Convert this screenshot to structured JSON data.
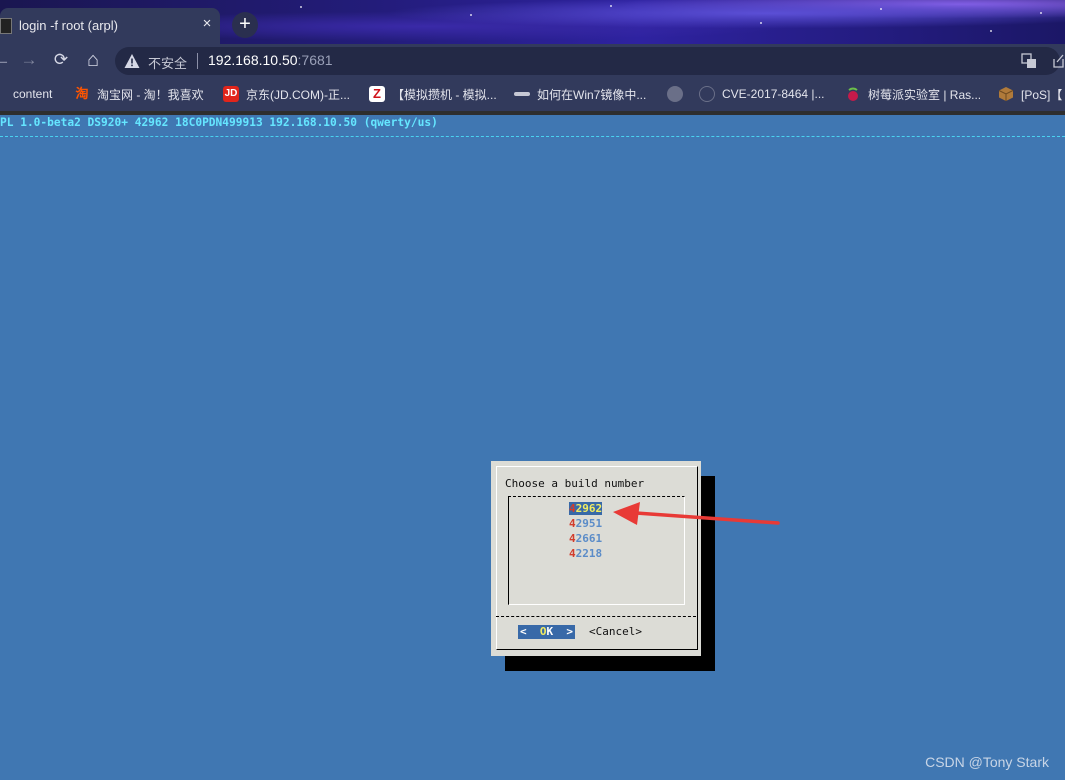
{
  "browser": {
    "tab_title": "login -f root (arpl)",
    "tab_close": "×",
    "new_tab": "+",
    "nav": {
      "back": "←",
      "forward": "→",
      "reload": "⟳",
      "home": "⌂"
    },
    "insecure_label": "不安全",
    "url_host": "192.168.10.50",
    "url_port": ":7681"
  },
  "bookmarks": [
    {
      "label": "content",
      "icon": "globe-icon",
      "glyph": ""
    },
    {
      "label": "淘宝网 - 淘！我喜欢",
      "icon": "taobao-icon",
      "glyph": "淘"
    },
    {
      "label": "京东(JD.COM)-正...",
      "icon": "jd-icon",
      "glyph": "JD"
    },
    {
      "label": "【模拟攒机 - 模拟...",
      "icon": "zol-icon",
      "glyph": "Z"
    },
    {
      "label": "如何在Win7镜像中...",
      "icon": "site-icon",
      "glyph": ""
    },
    {
      "label": "",
      "icon": "globe-icon",
      "glyph": ""
    },
    {
      "label": "CVE-2017-8464 |...",
      "icon": "shield-icon",
      "glyph": ""
    },
    {
      "label": "树莓派实验室 | Ras...",
      "icon": "raspberry-icon",
      "glyph": ""
    },
    {
      "label": "[PoS]【",
      "icon": "box-icon",
      "glyph": ""
    }
  ],
  "terminal": {
    "header": "PL 1.0-beta2 DS920+ 42962 18C0PDN499913 192.168.10.50 (qwerty/us)",
    "dialog": {
      "prompt": "Choose a build number",
      "items": [
        {
          "hotkey": "4",
          "rest": "2962",
          "selected": true
        },
        {
          "hotkey": "4",
          "rest": "2951",
          "selected": false
        },
        {
          "hotkey": "4",
          "rest": "2661",
          "selected": false
        },
        {
          "hotkey": "4",
          "rest": "2218",
          "selected": false
        }
      ],
      "ok_left": "<  ",
      "ok_hotkey": "O",
      "ok_rest": "K  >",
      "cancel": "<Cancel>"
    }
  },
  "watermark": "CSDN @Tony Stark",
  "colors": {
    "terminal_bg": "#4077b2",
    "arrow": "#e83a36",
    "highlight_bg": "#3869a8"
  }
}
